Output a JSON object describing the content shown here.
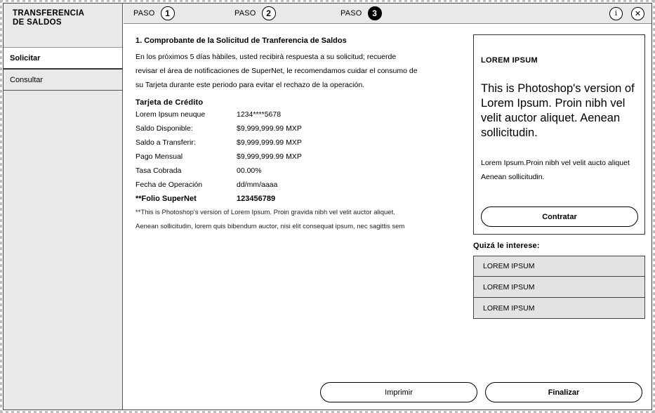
{
  "sidebar": {
    "title_line1": "TRANSFERENCIA",
    "title_line2": "DE SALDOS",
    "items": [
      {
        "label": "Solicitar"
      },
      {
        "label": "Consultar"
      }
    ]
  },
  "steps": [
    {
      "label": "PASO",
      "number": "1"
    },
    {
      "label": "PASO",
      "number": "2"
    },
    {
      "label": "PASO",
      "number": "3"
    }
  ],
  "toolbar": {
    "info_glyph": "i",
    "close_glyph": "✕"
  },
  "main": {
    "section_title": "1. Comprobante de la Solicitud de Tranferencia de Saldos",
    "intro_lines": [
      "En los próximos 5 días hàbiles, usted recibirà respuesta a su solicitud; recuerde",
      "revisar el área de notificaciones de SuperNet, le recomendamos cuidar el consumo de",
      "su Tarjeta durante este periodo para evitar el rechazo de la operación."
    ],
    "card_heading": "Tarjeta de Crédito",
    "details": [
      {
        "key": "Lorem Ipsum neuque",
        "value": "1234****5678"
      },
      {
        "key": "Saldo Disponible:",
        "value": "$9,999,999.99 MXP"
      },
      {
        "key": "Saldo a Transferir:",
        "value": "$9,999,999.99 MXP"
      },
      {
        "key": "Pago Mensual",
        "value": "$9,999,999.99 MXP"
      },
      {
        "key": "Tasa Cobrada",
        "value": "00.00%"
      },
      {
        "key": "Fecha de Operación",
        "value": "dd/mm/aaaa"
      }
    ],
    "folio": {
      "key": "**Folio SuperNet",
      "value": "123456789"
    },
    "note_lines": [
      "**This is Photoshop's version  of Lorem Ipsum. Proin gravida nibh vel velit auctor aliquet.",
      "Aenean sollicitudin, lorem quis bibendum auctor, nisi elit consequat ipsum, nec sagittis sem"
    ]
  },
  "promo": {
    "heading": "LOREM IPSUM",
    "big_text": "This is Photoshop's version of Lorem Ipsum. Proin nibh vel velit auctor aliquet. Aenean sollicitudin.",
    "small_text": "Lorem Ipsum.Proin nibh vel velit aucto aliquet Aenean sollicitudin.",
    "button": "Contratar"
  },
  "interest": {
    "heading": "Quizá le interese:",
    "items": [
      "LOREM IPSUM",
      "LOREM IPSUM",
      "LOREM IPSUM"
    ]
  },
  "actions": {
    "print": "Imprimir",
    "finish": "Finalizar"
  }
}
